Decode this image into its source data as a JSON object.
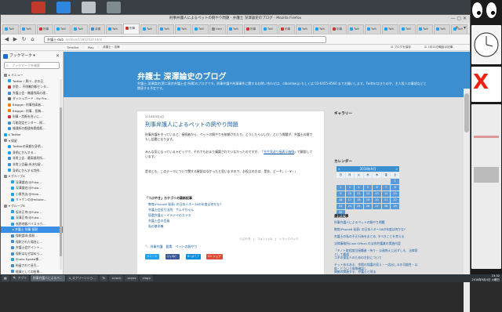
{
  "window": {
    "title": "刑事弁護人によるペットの飼やり問題 - 弁護士 深澤論史のブログ - Mozilla Firefox",
    "controls": "— ▢ ✕"
  },
  "tabs": [
    {
      "label": "Twit",
      "color": "#1da1f2"
    },
    {
      "label": "Twit",
      "color": "#1da1f2"
    },
    {
      "label": "刑事",
      "color": "#c33"
    },
    {
      "label": "Twit",
      "color": "#1da1f2"
    },
    {
      "label": "Twit",
      "color": "#1da1f2"
    },
    {
      "label": "弁護",
      "color": "#3b8fd0"
    },
    {
      "label": "Twit",
      "color": "#1da1f2"
    },
    {
      "label": "刑事",
      "color": "#c33"
    },
    {
      "label": "Twit",
      "color": "#1da1f2"
    },
    {
      "label": "Twit",
      "color": "#1da1f2"
    },
    {
      "label": "Twit",
      "color": "#1da1f2"
    },
    {
      "label": "Twit",
      "color": "#1da1f2"
    },
    {
      "label": "User",
      "color": "#888"
    },
    {
      "label": "Twit",
      "color": "#1da1f2"
    },
    {
      "label": "刑事",
      "color": "#c33"
    },
    {
      "label": "Twit",
      "color": "#1da1f2"
    },
    {
      "label": "刑事",
      "color": "#c33"
    },
    {
      "label": "Twit",
      "color": "#1da1f2"
    },
    {
      "label": "Twit",
      "color": "#1da1f2"
    },
    {
      "label": "刑事",
      "color": "#c33"
    },
    {
      "label": "Twit",
      "color": "#1da1f2"
    },
    {
      "label": "Twit",
      "color": "#1da1f2"
    },
    {
      "label": "Twit",
      "color": "#1da1f2"
    },
    {
      "label": "Twit",
      "color": "#1da1f2"
    },
    {
      "label": "Twit",
      "color": "#1da1f2"
    },
    {
      "label": "Twit",
      "color": "#1da1f2"
    },
    {
      "label": "Twit",
      "color": "#1da1f2"
    }
  ],
  "tab_controls": "+ ▾",
  "nav": {
    "back": "◀",
    "forward": "▶",
    "reload": "↻",
    "home": "⌂"
  },
  "url": {
    "host": "弁護士 dub",
    "path": ".archive/11812914.html"
  },
  "bookmarks_bar": {
    "item1": "Timeline",
    "item2": "Play",
    "sep": "・",
    "item3": "弁護士・法律",
    "check1": "☑ ブログを保存",
    "check2": "☑ 1月11日朝倉の記事"
  },
  "sidebar": {
    "title": "ブックマーク ▾",
    "close": "✕",
    "search_placeholder": "ブックマークを検索",
    "items": [
      {
        "label": "▸ メニュー",
        "indent": 0,
        "color": "#888"
      },
      {
        "label": "Twitter / 黒川 - 次の日",
        "indent": 5,
        "color": "#1da1f2"
      },
      {
        "label": "京院... 不明瞭判断センタ...",
        "indent": 5,
        "color": "#c33"
      },
      {
        "label": "弁護士会・機器残高の連...",
        "indent": 5,
        "color": "#3b8fd0"
      },
      {
        "label": "ダッシュボード - My Pro...",
        "indent": 5,
        "color": "#666"
      },
      {
        "label": "Blogger: 刑事残高者...",
        "indent": 5,
        "color": "#f57d00"
      },
      {
        "label": "Blogger: 刑事 - 投稿...",
        "indent": 5,
        "color": "#f57d00"
      },
      {
        "label": "刑事・判断を合いに...",
        "indent": 5,
        "color": "#c33"
      },
      {
        "label": "可能判定センター - 探...",
        "indent": 5,
        "color": "#3b8fd0"
      },
      {
        "label": "親通知の都道府県県県...",
        "indent": 5,
        "color": "#3b8fd0"
      },
      {
        "label": "▸ Twitter",
        "indent": 0,
        "color": "#1da1f2"
      },
      {
        "label": "▾ 保留",
        "indent": 0,
        "color": "#888"
      },
      {
        "label": "Twitterの高額な身柄...",
        "indent": 5,
        "color": "#1da1f2"
      },
      {
        "label": "身柄にかんする…",
        "indent": 5,
        "color": "#1da1f2"
      },
      {
        "label": "非常上告 - 最高裁判所...",
        "indent": 5,
        "color": "#3b8fd0"
      },
      {
        "label": "非常上告審(未決勾留...",
        "indent": 5,
        "color": "#3b8fd0"
      },
      {
        "label": "身柄にかんする判例...",
        "indent": 5,
        "color": "#1da1f2"
      },
      {
        "label": "▾ グループA",
        "indent": 0,
        "color": "#888"
      },
      {
        "label": "深澤論史(@Fuka...",
        "indent": 9,
        "color": "#1da1f2"
      },
      {
        "label": "深澤論史(@Fuka...",
        "indent": 9,
        "color": "#1da1f2"
      },
      {
        "label": "小原秀夫(@Hide...",
        "indent": 9,
        "color": "#1da1f2"
      },
      {
        "label": "ミトケンの@mitoke...",
        "indent": 9,
        "color": "#1da1f2"
      },
      {
        "label": "▾ グループB",
        "indent": 0,
        "color": "#888"
      },
      {
        "label": "坂本正幸(@Fuka...",
        "indent": 9,
        "color": "#1da1f2"
      },
      {
        "label": "深澤正幸(@Fuka...",
        "indent": 9,
        "color": "#1da1f2"
      },
      {
        "label": "長野地裁バリスラク...",
        "indent": 9,
        "color": "#1da1f2"
      },
      {
        "label": "▸ 弁護士 刑事 保釈",
        "indent": 5,
        "color": "#3b8fd0"
      },
      {
        "label": "保釈請求(保釈...",
        "indent": 9,
        "color": "#3b8fd0"
      },
      {
        "label": "保釈された場合に...",
        "indent": 9,
        "color": "#3b8fd0"
      },
      {
        "label": "弁護士会ポイント...",
        "indent": 9,
        "color": "#3b8fd0"
      },
      {
        "label": "保釈はなぜ認めら...",
        "indent": 9,
        "color": "#3b8fd0"
      },
      {
        "label": "Shoko Egawa様...",
        "indent": 9,
        "color": "#1da1f2"
      },
      {
        "label": "拘留されて長引...",
        "indent": 9,
        "color": "#3b8fd0"
      },
      {
        "label": "経緯としての結果...",
        "indent": 9,
        "color": "#3b8fd0"
      },
      {
        "label": "大谷剛宣(@...",
        "indent": 9,
        "color": "#1da1f2"
      },
      {
        "label": "サイボウdeseas...",
        "indent": 9,
        "color": "#1da1f2"
      },
      {
        "label": "各新聞のWebpor...",
        "indent": 9,
        "color": "#c33"
      },
      {
        "label": "(まちもち)保釈の人...",
        "indent": 9,
        "color": "#3b8fd0"
      },
      {
        "label": "弁護にまつわる...",
        "indent": 9,
        "color": "#3b8fd0"
      }
    ],
    "selected_index": 26
  },
  "blog": {
    "title": "弁護士 深澤論史のブログ",
    "description": "弁護士 深澤論史(第二東京弁護士会 所属)のブログです。刑事弁護や刑事事件に関するお問い合わせは、olbanlaw.jp もしくは 03-6455-8560 までお願いします。Twitterはきためや、主人役人の事項などと関連する予定です。",
    "post": {
      "date": "2018年9月4日",
      "title": "刑事弁護人によるペットの飼やり問題",
      "para1": "刑事弁護をやっていると、接続者から、ペットの飼やりを依頼されたり、どうしたらいいか、という問題が、弁護士の間でもし話題となります。",
      "para2_a": "みんな気になっているトピックで、それでもおまり議論されていなかったのですが、「",
      "para2_link": "先生見送り接表示価値",
      "para2_b": "」で解説しています。",
      "para3": "是非とも、このテーマについて関する解説はなかったと思いますので、お役立の方は、是非、ど〜ぞ。(・∀・)",
      "related_head": "「つぶやき」カテゴリの最新記事",
      "related": [
        "教育(Phone8 発表) の日本人ネ〜18の年度は何かな?",
        "弁護士会役引法院　サムヤちゃん",
        "国選弁護士・イメテイのカラス",
        "弁護士会の会員",
        "私の基本機"
      ],
      "footer": "つぶやき　|　コメント(0)　|　トラックバック",
      "tags_icon": "🏷",
      "tags": "刑事弁護　要素　ペットの飼やり",
      "share": [
        {
          "label": "ツイート",
          "color": "#1da1f2"
        },
        {
          "label": "いいね！",
          "color": "#3b5998"
        },
        {
          "label": "B! はてブ",
          "color": "#008fde"
        },
        {
          "label": "G+ シェア",
          "color": "#dd4b39"
        }
      ]
    },
    "sidebar": {
      "gallery_title": "ギャラリー",
      "calendar_title": "カレンダー",
      "calendar_month": "2018年9月",
      "calendar_prev": "«",
      "calendar_next": "»",
      "weekdays": [
        "日",
        "月",
        "火",
        "水",
        "木",
        "金",
        "土"
      ],
      "days": [
        "",
        "",
        "",
        "",
        "",
        "",
        "1",
        "2",
        "3",
        "4",
        "5",
        "6",
        "7",
        "8",
        "9",
        "10",
        "11",
        "12",
        "13",
        "14",
        "15",
        "16",
        "17",
        "18",
        "19",
        "20",
        "21",
        "22",
        "23",
        "24",
        "25",
        "26",
        "27",
        "28",
        "29",
        "30"
      ],
      "recent_title": "最新記事",
      "recent": [
        "刑事弁護人によるペットの飼やり問題",
        "教育(Phone8 発表) の日本人ネ〜18の年度は何かな?",
        "弁護士の私の不正行為をまとめ, すべきことを考える",
        "法律事務所(Law Office) の法的弁護業の実施内容",
        "「キノト取程度位接種者・待り~ 公務係えに必ずしも、法律家として最適",
        "コネの保証人のための方針について",
        "チットあるある、余暇の保護の見え・一応出しるの可能性・以前・どういう資格確認し",
        "情勢の関連する、弁護士と刑法",
        "弁護士 保証がだらない新たが説明になること"
      ]
    }
  },
  "right_desktop": {
    "x_glyph": "X"
  },
  "taskbar": {
    "items": [
      {
        "label": "▦",
        "active": false
      },
      {
        "label": "🔍 アプリ",
        "active": false
      },
      {
        "label": "刑事弁護人によるペ...",
        "active": true
      },
      {
        "label": "4_スクリーンショ...",
        "active": false
      },
      {
        "label": "Tk",
        "active": false
      },
      {
        "label": "xclock",
        "active": false
      },
      {
        "label": "xeyes",
        "active": false
      },
      {
        "label": "xlogo",
        "active": false
      }
    ],
    "time": "23:32",
    "date": "2018年9月4日 火曜日"
  }
}
